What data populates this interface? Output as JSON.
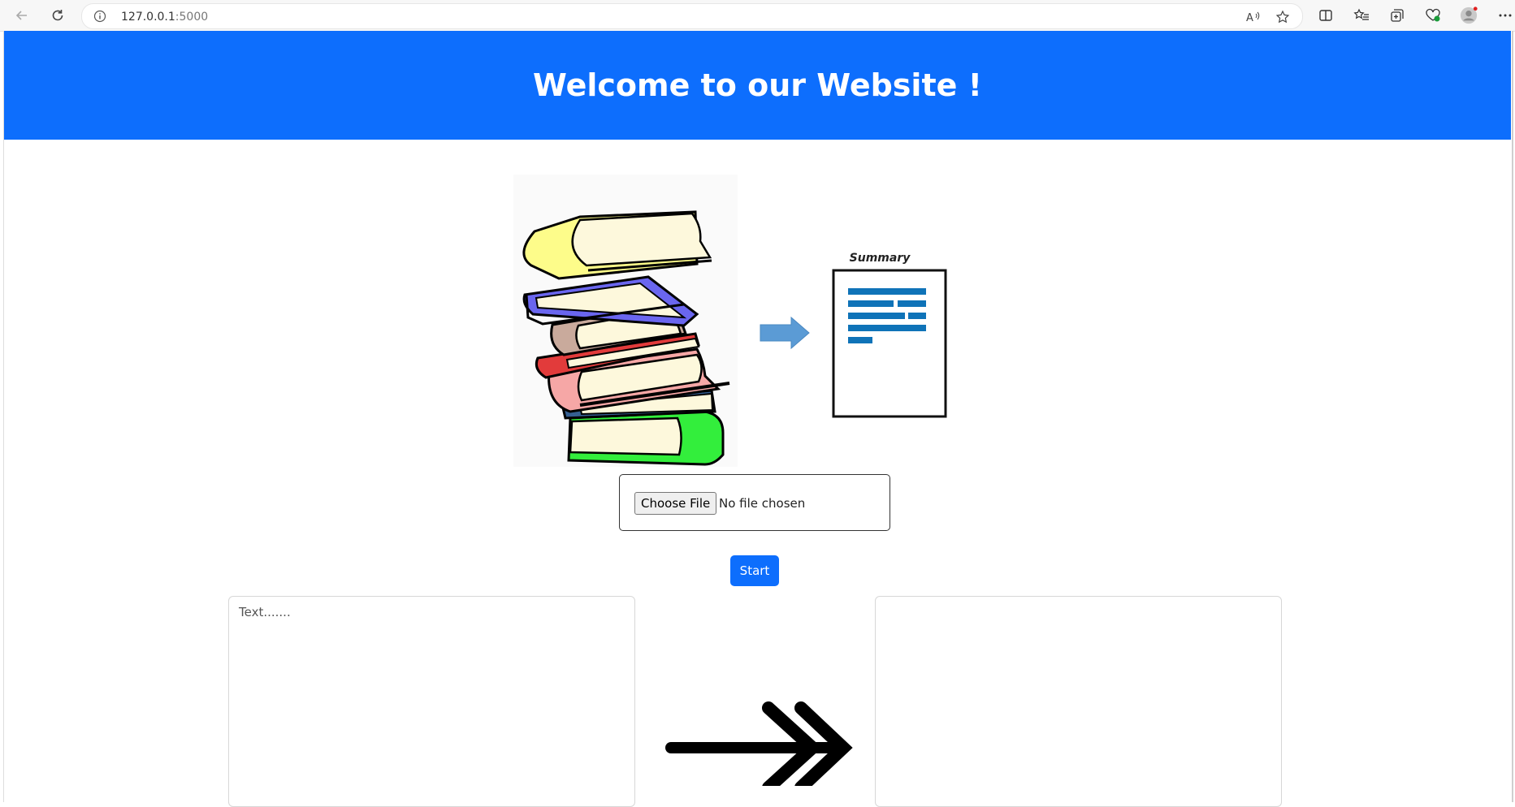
{
  "browser": {
    "url_host": "127.0.0.1",
    "url_port": ":5000",
    "icons": [
      "back-icon",
      "refresh-icon",
      "info-icon",
      "read-aloud-icon",
      "favorite-star-icon",
      "split-screen-icon",
      "favorites-icon",
      "collections-icon",
      "browser-essentials-icon",
      "profile-icon",
      "more-icon"
    ]
  },
  "header": {
    "title": "Welcome to our Website !",
    "background": "#0d6efd"
  },
  "illustration": {
    "summary_label": "Summary"
  },
  "upload": {
    "choose_label": "Choose File",
    "status": "No file chosen"
  },
  "actions": {
    "start_label": "Start",
    "color": "#0d6efd"
  },
  "input": {
    "placeholder": "Text.......",
    "value": ""
  },
  "output": {
    "value": ""
  }
}
